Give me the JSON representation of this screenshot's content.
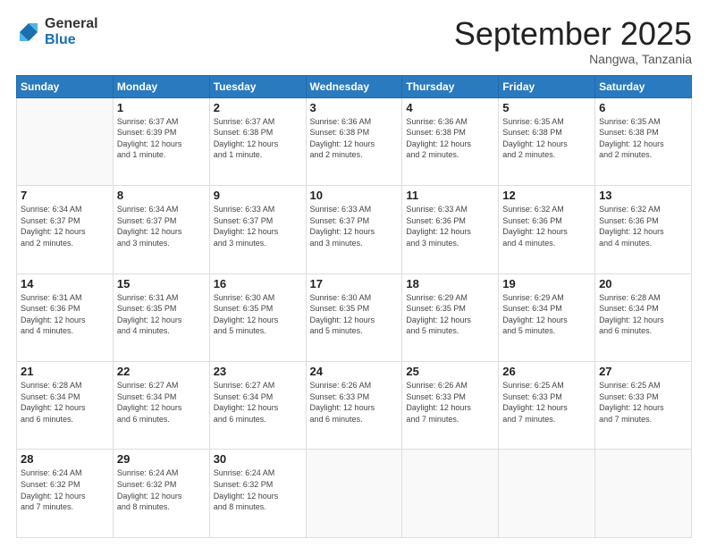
{
  "header": {
    "logo_general": "General",
    "logo_blue": "Blue",
    "month_title": "September 2025",
    "location": "Nangwa, Tanzania"
  },
  "days_of_week": [
    "Sunday",
    "Monday",
    "Tuesday",
    "Wednesday",
    "Thursday",
    "Friday",
    "Saturday"
  ],
  "weeks": [
    [
      {
        "num": "",
        "info": ""
      },
      {
        "num": "1",
        "info": "Sunrise: 6:37 AM\nSunset: 6:39 PM\nDaylight: 12 hours\nand 1 minute."
      },
      {
        "num": "2",
        "info": "Sunrise: 6:37 AM\nSunset: 6:38 PM\nDaylight: 12 hours\nand 1 minute."
      },
      {
        "num": "3",
        "info": "Sunrise: 6:36 AM\nSunset: 6:38 PM\nDaylight: 12 hours\nand 2 minutes."
      },
      {
        "num": "4",
        "info": "Sunrise: 6:36 AM\nSunset: 6:38 PM\nDaylight: 12 hours\nand 2 minutes."
      },
      {
        "num": "5",
        "info": "Sunrise: 6:35 AM\nSunset: 6:38 PM\nDaylight: 12 hours\nand 2 minutes."
      },
      {
        "num": "6",
        "info": "Sunrise: 6:35 AM\nSunset: 6:38 PM\nDaylight: 12 hours\nand 2 minutes."
      }
    ],
    [
      {
        "num": "7",
        "info": "Sunrise: 6:34 AM\nSunset: 6:37 PM\nDaylight: 12 hours\nand 2 minutes."
      },
      {
        "num": "8",
        "info": "Sunrise: 6:34 AM\nSunset: 6:37 PM\nDaylight: 12 hours\nand 3 minutes."
      },
      {
        "num": "9",
        "info": "Sunrise: 6:33 AM\nSunset: 6:37 PM\nDaylight: 12 hours\nand 3 minutes."
      },
      {
        "num": "10",
        "info": "Sunrise: 6:33 AM\nSunset: 6:37 PM\nDaylight: 12 hours\nand 3 minutes."
      },
      {
        "num": "11",
        "info": "Sunrise: 6:33 AM\nSunset: 6:36 PM\nDaylight: 12 hours\nand 3 minutes."
      },
      {
        "num": "12",
        "info": "Sunrise: 6:32 AM\nSunset: 6:36 PM\nDaylight: 12 hours\nand 4 minutes."
      },
      {
        "num": "13",
        "info": "Sunrise: 6:32 AM\nSunset: 6:36 PM\nDaylight: 12 hours\nand 4 minutes."
      }
    ],
    [
      {
        "num": "14",
        "info": "Sunrise: 6:31 AM\nSunset: 6:36 PM\nDaylight: 12 hours\nand 4 minutes."
      },
      {
        "num": "15",
        "info": "Sunrise: 6:31 AM\nSunset: 6:35 PM\nDaylight: 12 hours\nand 4 minutes."
      },
      {
        "num": "16",
        "info": "Sunrise: 6:30 AM\nSunset: 6:35 PM\nDaylight: 12 hours\nand 5 minutes."
      },
      {
        "num": "17",
        "info": "Sunrise: 6:30 AM\nSunset: 6:35 PM\nDaylight: 12 hours\nand 5 minutes."
      },
      {
        "num": "18",
        "info": "Sunrise: 6:29 AM\nSunset: 6:35 PM\nDaylight: 12 hours\nand 5 minutes."
      },
      {
        "num": "19",
        "info": "Sunrise: 6:29 AM\nSunset: 6:34 PM\nDaylight: 12 hours\nand 5 minutes."
      },
      {
        "num": "20",
        "info": "Sunrise: 6:28 AM\nSunset: 6:34 PM\nDaylight: 12 hours\nand 6 minutes."
      }
    ],
    [
      {
        "num": "21",
        "info": "Sunrise: 6:28 AM\nSunset: 6:34 PM\nDaylight: 12 hours\nand 6 minutes."
      },
      {
        "num": "22",
        "info": "Sunrise: 6:27 AM\nSunset: 6:34 PM\nDaylight: 12 hours\nand 6 minutes."
      },
      {
        "num": "23",
        "info": "Sunrise: 6:27 AM\nSunset: 6:34 PM\nDaylight: 12 hours\nand 6 minutes."
      },
      {
        "num": "24",
        "info": "Sunrise: 6:26 AM\nSunset: 6:33 PM\nDaylight: 12 hours\nand 6 minutes."
      },
      {
        "num": "25",
        "info": "Sunrise: 6:26 AM\nSunset: 6:33 PM\nDaylight: 12 hours\nand 7 minutes."
      },
      {
        "num": "26",
        "info": "Sunrise: 6:25 AM\nSunset: 6:33 PM\nDaylight: 12 hours\nand 7 minutes."
      },
      {
        "num": "27",
        "info": "Sunrise: 6:25 AM\nSunset: 6:33 PM\nDaylight: 12 hours\nand 7 minutes."
      }
    ],
    [
      {
        "num": "28",
        "info": "Sunrise: 6:24 AM\nSunset: 6:32 PM\nDaylight: 12 hours\nand 7 minutes."
      },
      {
        "num": "29",
        "info": "Sunrise: 6:24 AM\nSunset: 6:32 PM\nDaylight: 12 hours\nand 8 minutes."
      },
      {
        "num": "30",
        "info": "Sunrise: 6:24 AM\nSunset: 6:32 PM\nDaylight: 12 hours\nand 8 minutes."
      },
      {
        "num": "",
        "info": ""
      },
      {
        "num": "",
        "info": ""
      },
      {
        "num": "",
        "info": ""
      },
      {
        "num": "",
        "info": ""
      }
    ]
  ]
}
